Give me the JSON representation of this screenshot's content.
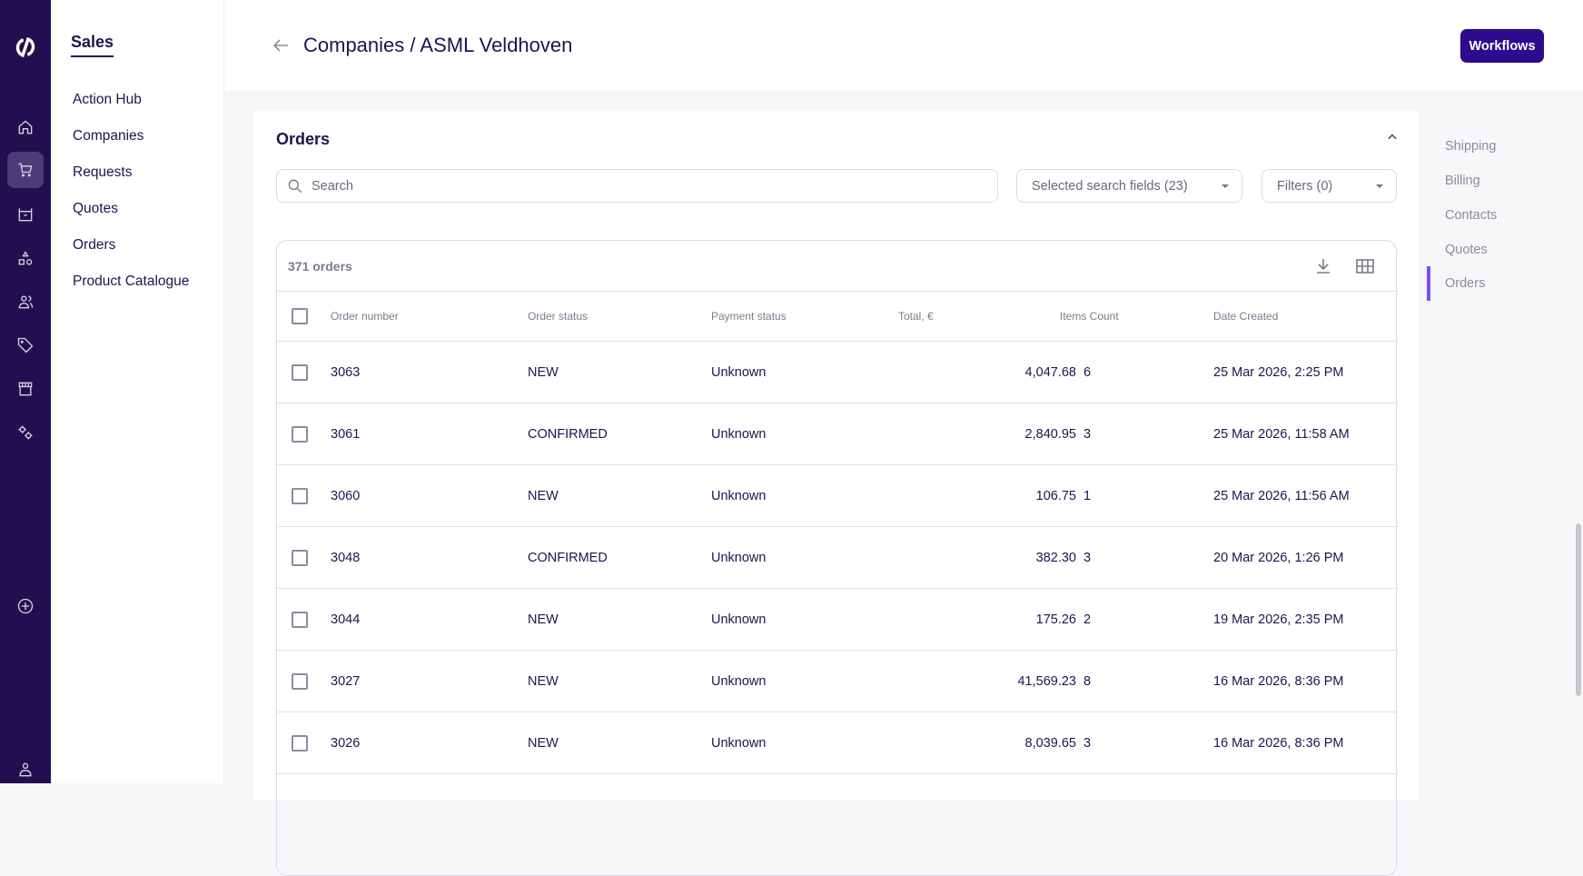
{
  "nav": {
    "section": "Sales",
    "items": [
      "Action Hub",
      "Companies",
      "Requests",
      "Quotes",
      "Orders",
      "Product Catalogue"
    ]
  },
  "rail": {
    "icons": [
      "logo-icon",
      "home-icon",
      "cart-icon",
      "box-icon",
      "shapes-icon",
      "users-icon",
      "tag-icon",
      "store-icon",
      "settings-icon",
      "add-icon",
      "profile-icon"
    ],
    "active": "cart-icon",
    "bg": "#220f4f"
  },
  "header": {
    "breadcrumb": "Companies / ASML Veldhoven",
    "workflows": "Workflows"
  },
  "orders": {
    "title": "Orders",
    "search_placeholder": "Search",
    "search_fields": "Selected search fields (23)",
    "filters": "Filters (0)",
    "count": "371 orders",
    "columns": [
      "Order number",
      "Order status",
      "Payment status",
      "Total, €",
      "Items Count",
      "Date Created"
    ],
    "rows": [
      [
        "3063",
        "NEW",
        "Unknown",
        "4,047.68",
        "6",
        "25 Mar 2026, 2:25 PM"
      ],
      [
        "3061",
        "CONFIRMED",
        "Unknown",
        "2,840.95",
        "3",
        "25 Mar 2026, 11:58 AM"
      ],
      [
        "3060",
        "NEW",
        "Unknown",
        "106.75",
        "1",
        "25 Mar 2026, 11:56 AM"
      ],
      [
        "3048",
        "CONFIRMED",
        "Unknown",
        "382.30",
        "3",
        "20 Mar 2026, 1:26 PM"
      ],
      [
        "3044",
        "NEW",
        "Unknown",
        "175.26",
        "2",
        "19 Mar 2026, 2:35 PM"
      ],
      [
        "3027",
        "NEW",
        "Unknown",
        "41,569.23",
        "8",
        "16 Mar 2026, 8:36 PM"
      ],
      [
        "3026",
        "NEW",
        "Unknown",
        "8,039.65",
        "3",
        "16 Mar 2026, 8:36 PM"
      ]
    ]
  },
  "section_nav": {
    "items": [
      "Shipping",
      "Billing",
      "Contacts",
      "Quotes",
      "Orders"
    ],
    "active": "Orders"
  }
}
